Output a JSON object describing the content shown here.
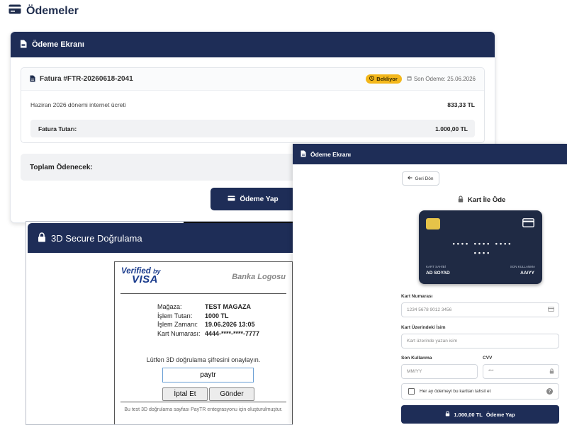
{
  "page": {
    "title": "Ödemeler",
    "icon": "credit-card-icon"
  },
  "base_card": {
    "header": "Ödeme Ekranı",
    "invoice": {
      "number": "Fatura #FTR-20260618-2041",
      "status": "Bekliyor",
      "due": "Son Ödeme: 25.06.2026",
      "line_desc": "Haziran 2026 dönemi internet ücreti",
      "line_amount": "833,33 TL",
      "total_label": "Fatura Tutarı:",
      "total_value": "1.000,00 TL"
    },
    "grand_total_label": "Toplam Ödenecek:",
    "pay_button": "Ödeme Yap"
  },
  "secure": {
    "header": "3D Secure Doğrulama",
    "verified_text": "Verified",
    "verified_by": "by",
    "visa": "VISA",
    "bank_logo": "Banka Logosu",
    "rows": [
      {
        "k": "Mağaza:",
        "v": "TEST MAGAZA"
      },
      {
        "k": "İşlem Tutarı:",
        "v": "1000 TL"
      },
      {
        "k": "İşlem Zamanı:",
        "v": "19.06.2026 13:05"
      },
      {
        "k": "Kart Numarası:",
        "v": "4444-****-****-7777"
      }
    ],
    "prompt": "Lütfen 3D doğrulama şifresini onaylayın.",
    "otp_value": "paytr",
    "cancel": "İptal Et",
    "submit": "Gönder",
    "footer": "Bu test 3D doğrulama sayfası PayTR entegrasyonu için oluşturulmuştur."
  },
  "card_panel": {
    "header": "Ödeme Ekranı",
    "back": "Geri Dön",
    "title": "Kart İle Öde",
    "card": {
      "dots_line1": "•••• •••• ••••",
      "dots_line2": "••••",
      "holder_label": "KART SAHİBİ",
      "holder_value": "AD SOYAD",
      "expiry_label": "SON KULLANMA",
      "expiry_value": "AA/YY"
    },
    "fields": {
      "number_label": "Kart Numarası",
      "number_placeholder": "1234 5678 9012 3456",
      "name_label": "Kart Üzerindeki İsim",
      "name_placeholder": "Kart üzerinde yazan isim",
      "expiry_label": "Son Kullanma",
      "expiry_placeholder": "MM/YY",
      "cvv_label": "CVV",
      "cvv_placeholder": "***"
    },
    "save_card": "Her ay ödemeyi bu karttan tahsil et",
    "help": "?",
    "pay_amount": "1.000,00 TL",
    "pay_label": "Ödeme Yap"
  },
  "colors": {
    "navy": "#1e2d57",
    "badge": "#f3b71b",
    "chip": "#e6c349"
  }
}
